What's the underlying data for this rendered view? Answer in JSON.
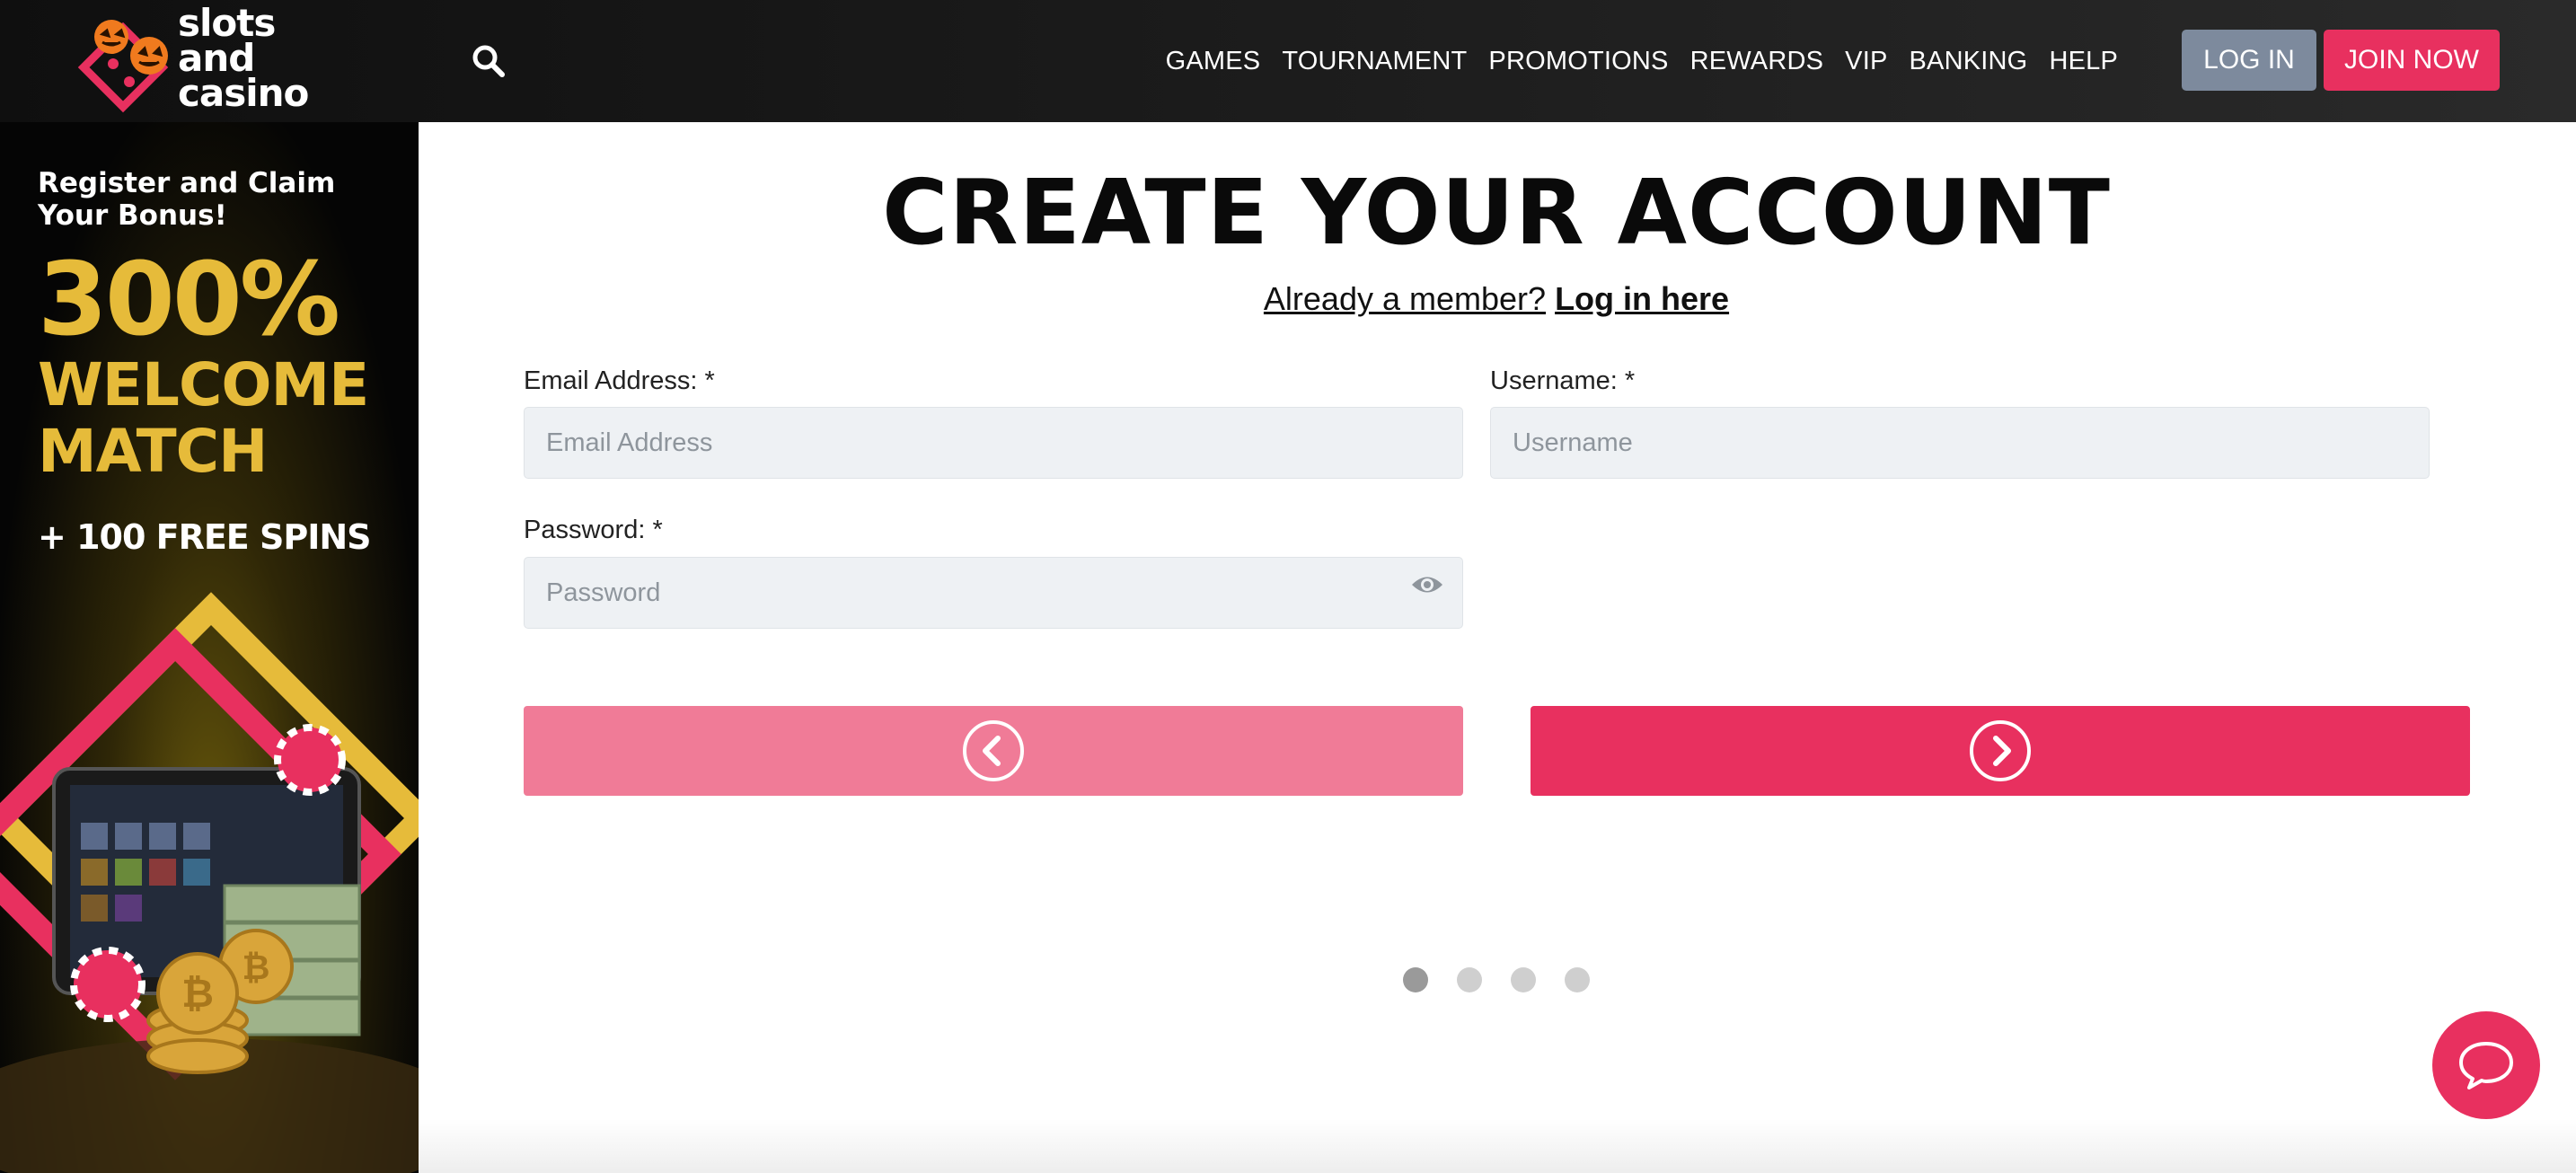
{
  "brand": {
    "logo_lines": [
      "slots",
      "and",
      "casino"
    ],
    "accent_color": "#e8305f",
    "gold_color": "#e6bb3a"
  },
  "header": {
    "search_icon": "search-icon",
    "nav": [
      "GAMES",
      "TOURNAMENT",
      "PROMOTIONS",
      "REWARDS",
      "VIP",
      "BANKING",
      "HELP"
    ],
    "login_label": "LOG IN",
    "join_label": "JOIN NOW"
  },
  "promo": {
    "register": "Register and Claim Your Bonus!",
    "percent": "300%",
    "line1": "WELCOME",
    "line2": "MATCH",
    "spins": "+ 100 FREE SPINS"
  },
  "form": {
    "title": "CREATE YOUR ACCOUNT",
    "member_prompt": "Already a member?",
    "login_link": "Log in here",
    "email": {
      "label": "Email Address: *",
      "placeholder": "Email Address",
      "value": ""
    },
    "username": {
      "label": "Username: *",
      "placeholder": "Username",
      "value": ""
    },
    "password": {
      "label": "Password: *",
      "placeholder": "Password",
      "value": "",
      "toggle_icon": "eye-icon"
    },
    "prev_icon": "chevron-left-icon",
    "next_icon": "chevron-right-icon",
    "steps_total": 4,
    "current_step": 1
  },
  "chat": {
    "icon": "chat-bubble-icon"
  }
}
